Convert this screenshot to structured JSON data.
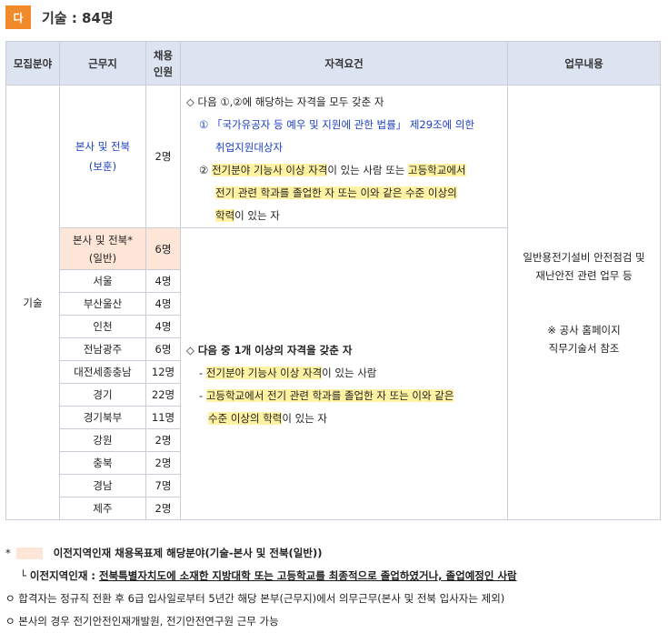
{
  "header": {
    "badge": "다",
    "title": "기술 : 84명"
  },
  "table": {
    "columns": [
      "모집분야",
      "근무지",
      "채용\n인원",
      "자격요건",
      "업무내용"
    ],
    "field": "기술",
    "rows": [
      {
        "location": "본사 및 전북\n(보훈)",
        "count": "2명"
      },
      {
        "location": "본사 및 전북*\n(일반)",
        "count": "6명"
      },
      {
        "location": "서울",
        "count": "4명"
      },
      {
        "location": "부산울산",
        "count": "4명"
      },
      {
        "location": "인천",
        "count": "4명"
      },
      {
        "location": "전남광주",
        "count": "6명"
      },
      {
        "location": "대전세종충남",
        "count": "12명"
      },
      {
        "location": "경기",
        "count": "22명"
      },
      {
        "location": "경기북부",
        "count": "11명"
      },
      {
        "location": "강원",
        "count": "2명"
      },
      {
        "location": "충북",
        "count": "2명"
      },
      {
        "location": "경남",
        "count": "7명"
      },
      {
        "location": "제주",
        "count": "2명"
      }
    ],
    "req1": {
      "intro": "◇ 다음 ①,②에 해당하는 자격을 모두 갖춘 자",
      "item1_a": "① 「국가유공자 등 예우 및 지원에 관한 법률」 제29조에 의한",
      "item1_b": "취업지원대상자",
      "item2_num": "② ",
      "item2_a_hl": "전기분야 기능사 이상 자격",
      "item2_a_mid": "이 있는 사람 또는 ",
      "item2_a_hl2": "고등학교에서",
      "item2_b_hl": "전기 관련 학과를 졸업한 자 또는 이와 같은 수준 이상의",
      "item2_c_hl": "학력",
      "item2_c_rest": "이 있는 자"
    },
    "req2": {
      "intro": "◇ 다음 중 1개 이상의 자격을 갖춘 자",
      "item1_dash": "- ",
      "item1_hl": "전기분야 기능사 이상 자격",
      "item1_rest": "이 있는 사람",
      "item2_dash": "- ",
      "item2_hl": "고등학교에서 전기 관련 학과를 졸업한 자 또는 이와 같은",
      "item2_b_hl": "수준 이상의 학력",
      "item2_b_rest": "이 있는 자"
    },
    "duty": {
      "line1": "일반용전기설비 안전점검 및",
      "line2": "재난안전 관련 업무 등",
      "note1": "※ 공사 홈페이지",
      "note2": "직무기술서 참조"
    }
  },
  "notes": {
    "legend_star": "*",
    "legend_text": "이전지역인재 채용목표제 해당분야(기술-본사 및 전북(일반))",
    "local_talent_label": "└ 이전지역인재 : ",
    "local_talent_text": "전북특별자치도에 소재한 지방대학 또는 고등학교를 최종적으로 졸업하였거나, 졸업예정인 사람",
    "note1": "ㅇ 합격자는 정규직 전환 후 6급 입사일로부터 5년간 해당 본부(근무지)에서 의무근무(본사 및 전북 입사자는 제외)",
    "note2": "ㅇ 본사의 경우 전기안전인재개발원, 전기안전연구원 근무 가능"
  },
  "colors": {
    "badge": "#f08a2a",
    "header_bg": "#dde4f1",
    "highlight": "#fff3a3",
    "peach": "#fde6d7",
    "blue_text": "#1c3fc0"
  }
}
